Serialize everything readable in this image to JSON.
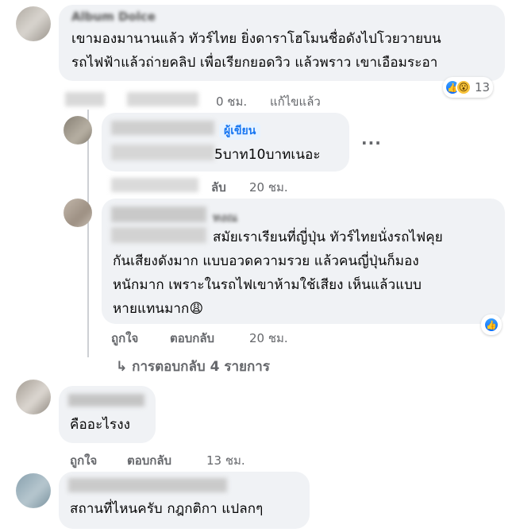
{
  "comments": [
    {
      "name": "Album Dolce",
      "lines": [
        "เขามองมานานแล้ว ทัวร์ไทย ยิ่งดาราโฮโมนชื่อดังไปโวยวายบน",
        "รถไฟฟ้าแล้วถ่ายคลิป เพื่อเรียกยอดวิว แล้วพราว เขาเอือมระอา"
      ],
      "time": "0 ชม.",
      "edited": "แก้ไขแล้ว",
      "reaction_count": "13"
    },
    {
      "author_badge": "ผู้เขียน",
      "lines": [
        "5บาท10บาทเนอะ"
      ],
      "reply": "ลับ",
      "time": "20 ชม.",
      "more": "···"
    },
    {
      "name": "ทงณ",
      "lines": [
        "สมัยเราเรียนที่ญี่ปุ่น ทัวร์ไทยนั่งรถไฟคุย",
        "กันเสียงดังมาก แบบอวดความรวย แล้วคนญี่ปุ่นก็มอง",
        "หนักมาก เพราะในรถไฟเขาห้ามใช้เสียง เห็นแล้วแบบ",
        "หายแทนมาก😩"
      ],
      "like": "ถูกใจ",
      "reply": "ตอบกลับ",
      "time": "20 ชม."
    },
    {
      "lines": [
        "คืออะไรงง"
      ],
      "like": "ถูกใจ",
      "reply": "ตอบกลับ",
      "time": "13 ชม."
    },
    {
      "lines": [
        "สถานที่ไหนครับ กฎกติกา แปลกๆ"
      ]
    }
  ],
  "view_replies": "↳ การตอบกลับ 4 รายการ",
  "colors": {
    "bubble": "#f0f2f5",
    "secondary_text": "#65676b",
    "author_badge_bg": "#e7f3ff",
    "author_badge_text": "#1877f2",
    "like_blue": "#1877f2"
  }
}
